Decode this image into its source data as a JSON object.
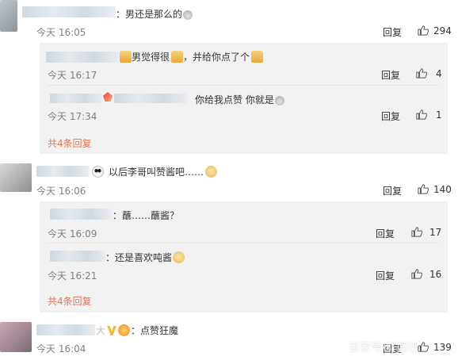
{
  "colors": {
    "link": "#eb7350",
    "time": "#808080",
    "reply_box": "#f2f2f2"
  },
  "comments": [
    {
      "text": "：男还是那么的",
      "time": "今天 16:05",
      "reply": "回复",
      "likes": "294",
      "replies": [
        {
          "text": "男觉得很",
          "text2": "，并给你点了个",
          "time": "今天 16:17",
          "reply": "回复",
          "likes": "4"
        },
        {
          "text": "你给我点赞 你就是",
          "time": "今天 17:34",
          "reply": "回复",
          "likes": "1"
        }
      ],
      "more": "共4条回复"
    },
    {
      "text": "以后李哥叫赞酱吧……",
      "time": "今天 16:06",
      "reply": "回复",
      "likes": "140",
      "replies": [
        {
          "text": "：蘸……蘸酱？",
          "time": "今天 16:09",
          "reply": "回复",
          "likes": "17"
        },
        {
          "text": "：还是喜欢吨酱",
          "time": "今天 16:21",
          "reply": "回复",
          "likes": "16"
        }
      ],
      "more": "共4条回复"
    },
    {
      "text": "：点赞狂魔",
      "prefix": "大",
      "time": "今天 16:04",
      "reply": "回复",
      "likes": "139"
    }
  ],
  "watermark": "百家号/鲜娱社"
}
